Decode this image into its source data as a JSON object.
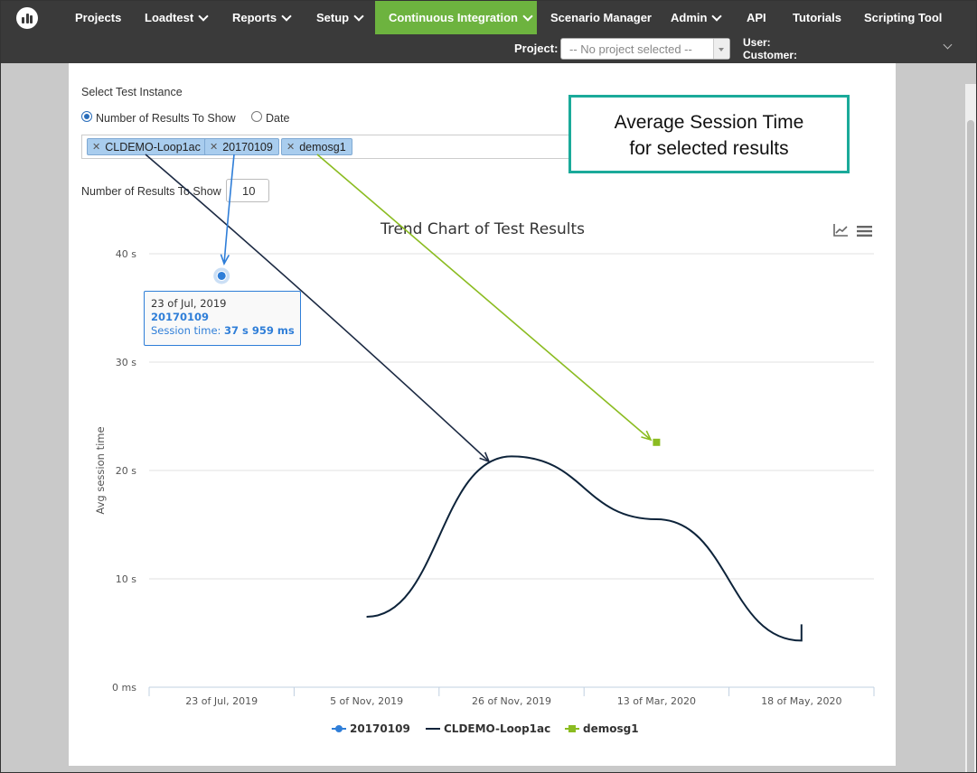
{
  "nav": {
    "items": [
      {
        "label": "Projects",
        "dropdown": false,
        "active": false
      },
      {
        "label": "Loadtest",
        "dropdown": true,
        "active": false
      },
      {
        "label": "Reports",
        "dropdown": true,
        "active": false
      },
      {
        "label": "Setup",
        "dropdown": true,
        "active": false
      },
      {
        "label": "Continuous Integration",
        "dropdown": true,
        "active": true
      },
      {
        "label": "Scenario Manager",
        "dropdown": false,
        "active": false
      },
      {
        "label": "Admin",
        "dropdown": true,
        "active": false
      },
      {
        "label": "API",
        "dropdown": false,
        "active": false
      },
      {
        "label": "Tutorials",
        "dropdown": false,
        "active": false
      },
      {
        "label": "Scripting Tool",
        "dropdown": false,
        "active": false
      }
    ],
    "active_color": "#6db33f",
    "bar_color": "#3a3a3a"
  },
  "project": {
    "label": "Project:",
    "selected": "-- No project selected --",
    "user_label": "User:",
    "customer_label": "Customer:"
  },
  "form": {
    "select_instance_label": "Select Test Instance",
    "radio_results": "Number of Results To Show",
    "radio_date": "Date",
    "radio_selected": "results",
    "tags": [
      "CLDEMO-Loop1ac",
      "20170109",
      "demosg1"
    ],
    "results_label": "Number of Results To Show",
    "results_value": "10"
  },
  "callout": {
    "line1": "Average Session Time",
    "line2": "for selected results",
    "border_color": "#1aaa9a"
  },
  "tooltip": {
    "date": "23 of Jul, 2019",
    "series": "20170109",
    "metric_label": "Session time: ",
    "metric_value": "37 s 959 ms"
  },
  "chart_data": {
    "type": "line",
    "title": "Trend Chart of Test Results",
    "ylabel": "Avg session time",
    "xlabel": "",
    "y_ticks": [
      "0 ms",
      "10 s",
      "20 s",
      "30 s",
      "40 s"
    ],
    "ylim": [
      0,
      40
    ],
    "x_ticks": [
      "23 of Jul, 2019",
      "5 of Nov, 2019",
      "26 of Nov, 2019",
      "13 of Mar, 2020",
      "18 of May, 2020"
    ],
    "grid": true,
    "legend_position": "bottom",
    "series": [
      {
        "name": "20170109",
        "color": "#2f7ed8",
        "marker": "circle",
        "points": [
          {
            "x": "23 of Jul, 2019",
            "y": 37.96
          }
        ]
      },
      {
        "name": "CLDEMO-Loop1ac",
        "color": "#0d233a",
        "marker": "none",
        "points": [
          {
            "x": "5 of Nov, 2019",
            "y": 6.5
          },
          {
            "x": "26 of Nov, 2019",
            "y": 21.3
          },
          {
            "x": "13 of Mar, 2020",
            "y": 15.5
          },
          {
            "x": "18 of May, 2020",
            "y": 4.3
          },
          {
            "x": "18 of May, 2020",
            "y": 5.8
          }
        ]
      },
      {
        "name": "demosg1",
        "color": "#8bbc21",
        "marker": "square",
        "points": [
          {
            "x": "13 of Mar, 2020",
            "y": 22.6
          }
        ]
      }
    ]
  }
}
